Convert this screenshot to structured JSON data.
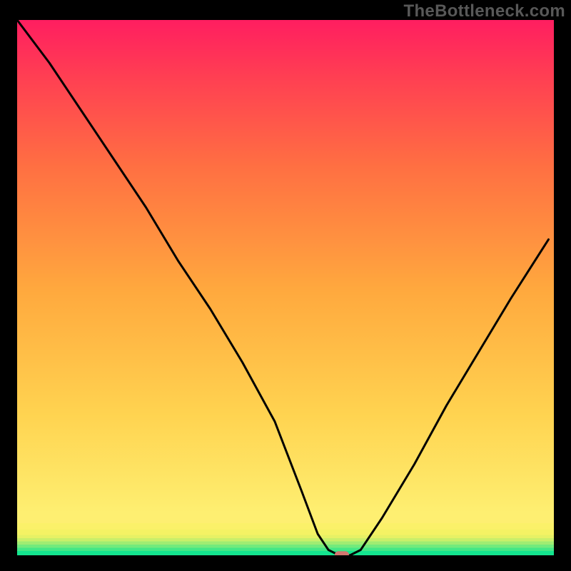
{
  "watermark": "TheBottleneck.com",
  "chart_data": {
    "type": "line",
    "title": "",
    "xlabel": "",
    "ylabel": "",
    "xlim": [
      0,
      100
    ],
    "ylim": [
      0,
      100
    ],
    "grid": false,
    "series": [
      {
        "name": "curve",
        "x": [
          0,
          6,
          12,
          18,
          24,
          30,
          36,
          42,
          48,
          53,
          56,
          58,
          60,
          62,
          64,
          68,
          74,
          80,
          86,
          92,
          99
        ],
        "y": [
          100,
          92,
          83,
          74,
          65,
          55,
          46,
          36,
          25,
          12,
          4,
          1,
          0,
          0,
          1,
          7,
          17,
          28,
          38,
          48,
          59
        ]
      }
    ],
    "solid_bands": [
      {
        "from": 0.0,
        "to": 0.8,
        "color": "#14e58f"
      },
      {
        "from": 0.8,
        "to": 1.4,
        "color": "#43e786"
      },
      {
        "from": 1.4,
        "to": 2.0,
        "color": "#73ea7c"
      },
      {
        "from": 2.0,
        "to": 2.6,
        "color": "#a0ec72"
      },
      {
        "from": 2.6,
        "to": 3.2,
        "color": "#c9ef6a"
      },
      {
        "from": 3.2,
        "to": 3.8,
        "color": "#e6f165"
      },
      {
        "from": 3.8,
        "to": 4.8,
        "color": "#f4f264"
      },
      {
        "from": 4.8,
        "to": 6.0,
        "color": "#fbf169"
      },
      {
        "from": 6.0,
        "to": 8.0,
        "color": "#feef71"
      }
    ],
    "gradient_range": {
      "from": 8.0,
      "to": 100.0
    },
    "gradient_stops": [
      {
        "pos": 0.0,
        "color": "#feef71"
      },
      {
        "pos": 0.2,
        "color": "#ffd350"
      },
      {
        "pos": 0.45,
        "color": "#ffa93e"
      },
      {
        "pos": 0.7,
        "color": "#ff7042"
      },
      {
        "pos": 0.88,
        "color": "#ff4052"
      },
      {
        "pos": 1.0,
        "color": "#ff1e60"
      }
    ],
    "marker": {
      "x": 60.5,
      "y": 0.1
    }
  }
}
